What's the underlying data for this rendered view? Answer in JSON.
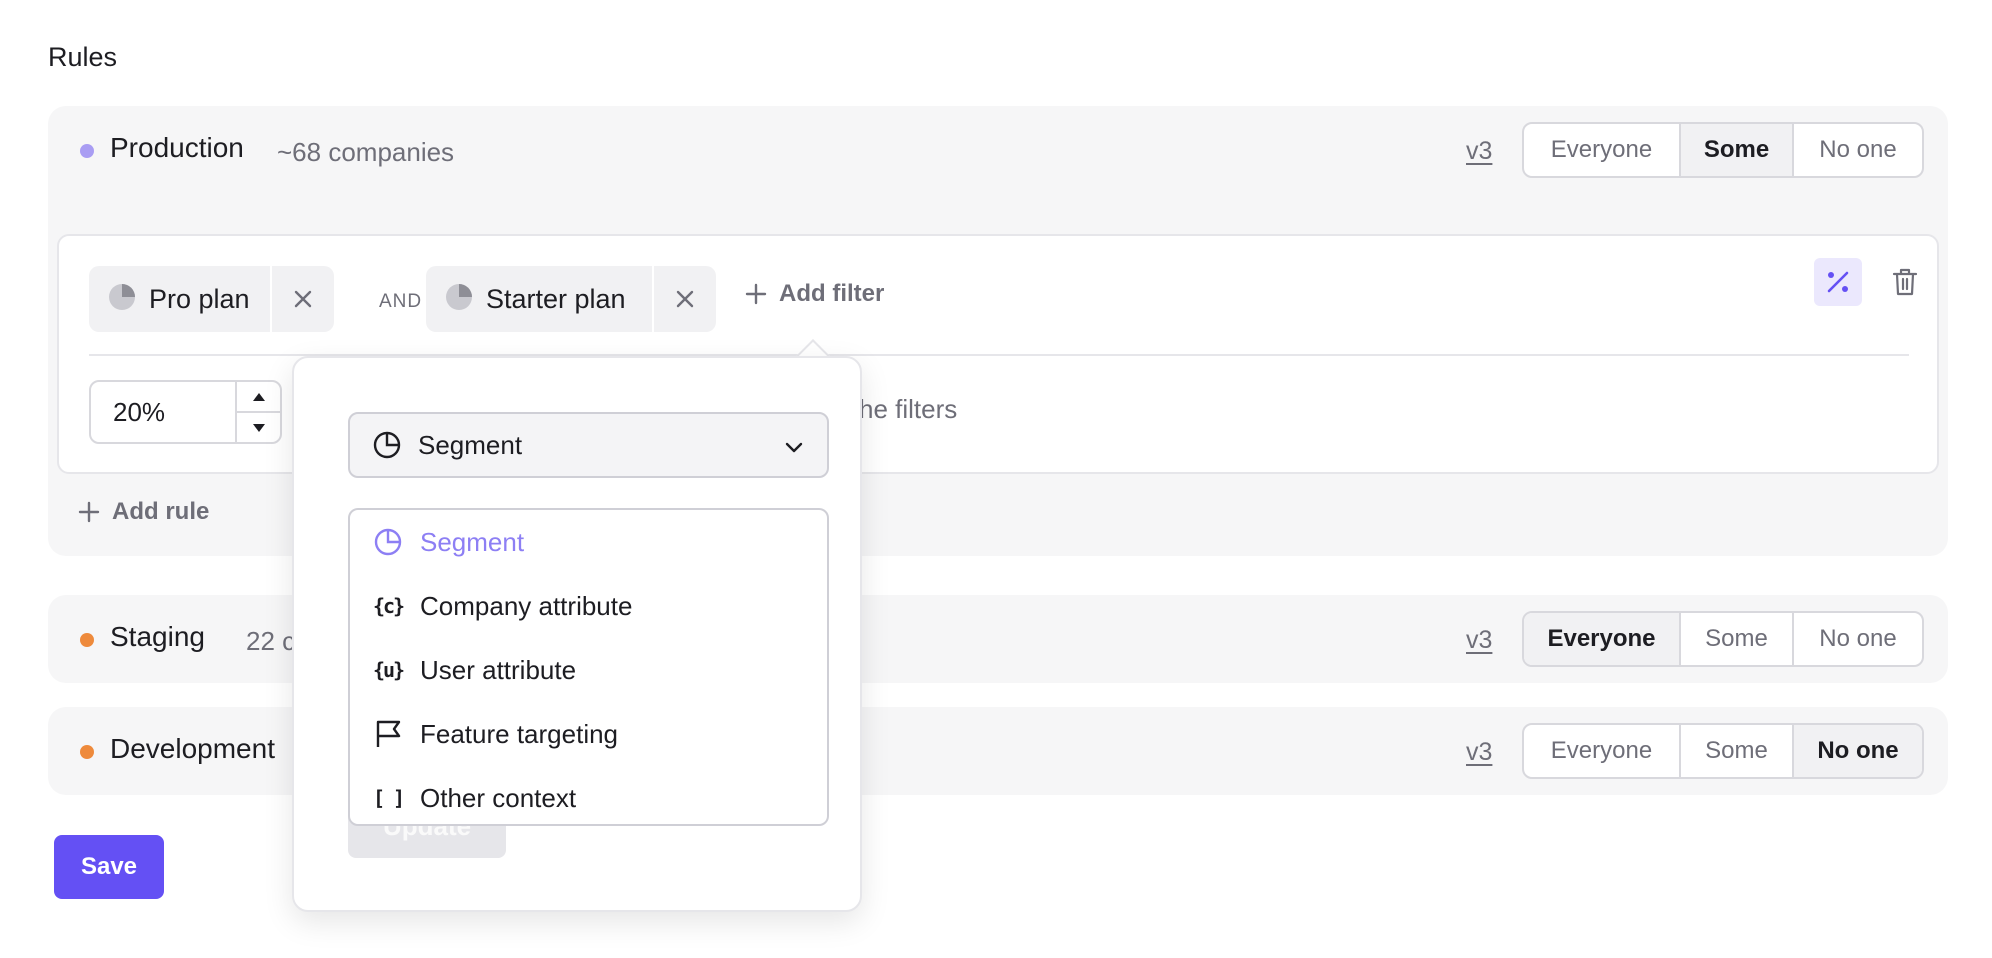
{
  "page": {
    "heading": "Rules"
  },
  "segment_options": [
    "Everyone",
    "Some",
    "No one"
  ],
  "colors": {
    "accent": "#6450f4",
    "production_dot": "#a99df3",
    "env_dot_orange": "#ee8a3c",
    "selected_item": "#8d7ff4"
  },
  "environments": {
    "production": {
      "name": "Production",
      "count": "~68 companies",
      "version": "v3",
      "selected": "Some",
      "rule": {
        "filters": [
          {
            "label": "Pro plan",
            "icon": "segment-pie-icon"
          },
          {
            "label": "Starter plan",
            "icon": "segment-pie-icon"
          }
        ],
        "operator": "AND",
        "add_filter_label": "Add filter",
        "rollout_value": "20%",
        "rollout_text": "he filters"
      },
      "add_rule_label": "Add rule"
    },
    "staging": {
      "name": "Staging",
      "count": "22 c",
      "version": "v3",
      "selected": "Everyone"
    },
    "development": {
      "name": "Development",
      "version": "v3",
      "selected": "No one"
    }
  },
  "popover": {
    "select_value": "Segment",
    "options": [
      {
        "label": "Segment",
        "icon": "pie-chart-icon",
        "selected": true
      },
      {
        "label": "Company attribute",
        "icon": "company-braces-icon",
        "glyph": "{c}"
      },
      {
        "label": "User attribute",
        "icon": "user-braces-icon",
        "glyph": "{u}"
      },
      {
        "label": "Feature targeting",
        "icon": "flag-icon"
      },
      {
        "label": "Other context",
        "icon": "brackets-icon",
        "glyph": "[ ]"
      }
    ],
    "update_label": "Update"
  },
  "save_label": "Save"
}
